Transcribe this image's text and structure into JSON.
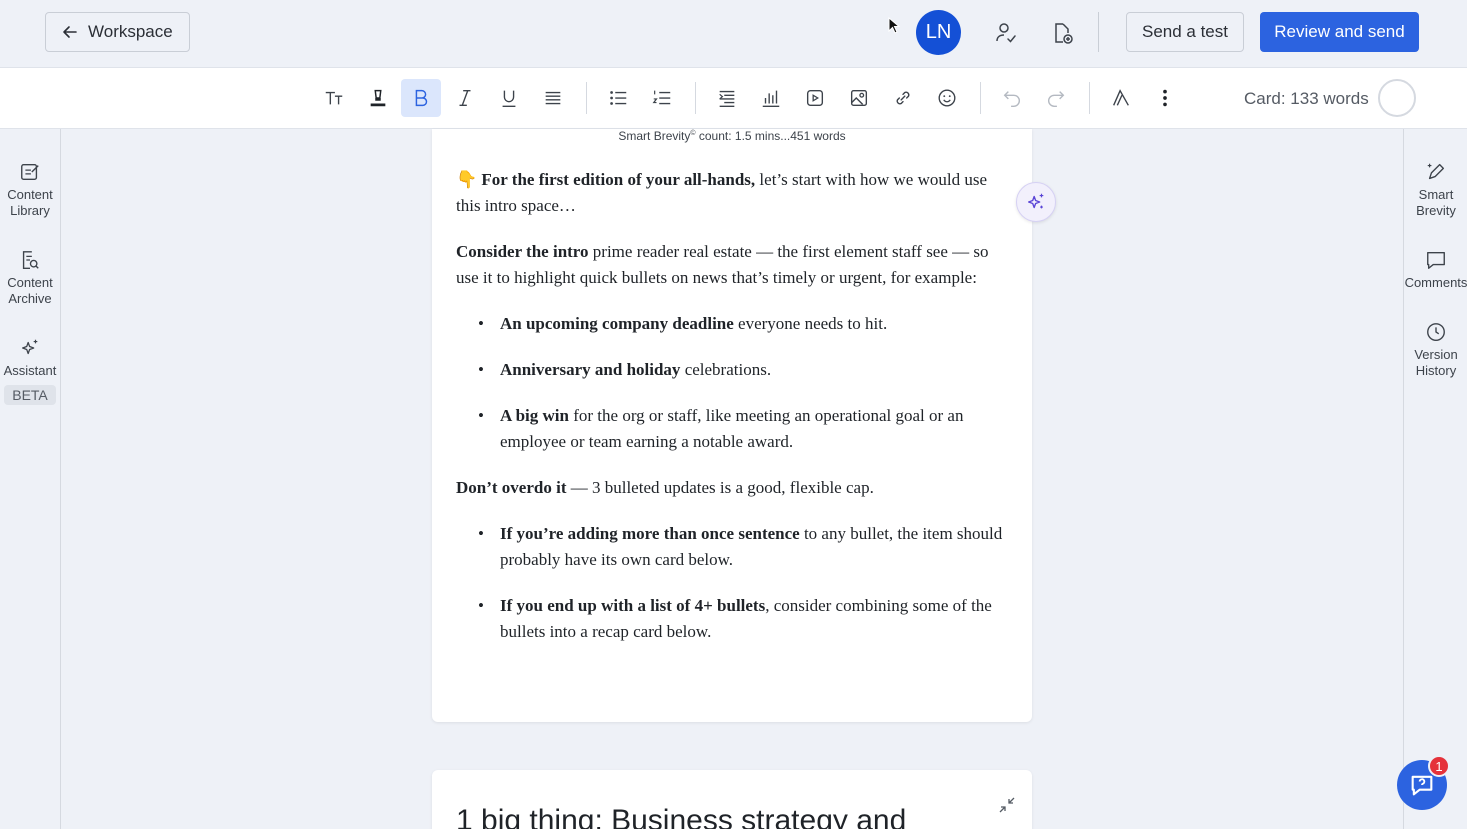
{
  "header": {
    "back_label": "Workspace",
    "avatar_initials": "LN",
    "send_test_label": "Send a test",
    "review_send_label": "Review and send",
    "accent": "#2c63e0"
  },
  "toolbar": {
    "tools": [
      "text-style",
      "highlight",
      "bold",
      "italic",
      "underline",
      "align",
      "bulleted-list",
      "numbered-list",
      "divider-insert",
      "chart",
      "embed",
      "image",
      "link",
      "emoji",
      "undo",
      "redo",
      "brand-style",
      "more"
    ],
    "active_tool": "bold",
    "word_count": "Card: 133 words"
  },
  "left_rail": {
    "items": [
      {
        "label": "Content Library",
        "icon": "edit-note-icon"
      },
      {
        "label": "Content Archive",
        "icon": "archive-search-icon"
      },
      {
        "label": "Assistant",
        "icon": "sparkle-icon",
        "badge": "BETA"
      }
    ]
  },
  "right_rail": {
    "items": [
      {
        "label": "Smart Brevity",
        "icon": "pen-sparkle-icon"
      },
      {
        "label": "Comments",
        "icon": "comment-icon"
      },
      {
        "label": "Version History",
        "icon": "clock-icon"
      }
    ]
  },
  "card": {
    "smart_brevity_prefix": "Smart Brevity",
    "smart_brevity_mark": "©",
    "smart_brevity_suffix": " count: 1.5 mins...451 words",
    "p1_emoji": "👇",
    "p1_bold": "For the first edition of your all-hands,",
    "p1_rest": " let’s start with how we would use this intro space…",
    "p2_bold": "Consider the intro",
    "p2_rest": " prime reader real estate — the first element staff see — so use it to highlight quick bullets on news that’s timely or urgent, for example:",
    "bullets1": [
      {
        "bold": "An upcoming company deadline",
        "rest": " everyone needs to hit."
      },
      {
        "bold": "Anniversary and holiday",
        "rest": " celebrations."
      },
      {
        "bold": "A big win",
        "rest": " for the org or staff, like meeting an operational goal or an employee or team earning a notable award."
      }
    ],
    "p3_bold": "Don’t overdo it",
    "p3_rest": " — 3 bulleted updates is a good, flexible cap.",
    "bullets2": [
      {
        "bold": "If you’re adding more than once sentence",
        "rest": " to any bullet, the item should probably have its own card below."
      },
      {
        "bold": "If you end up with a list of 4+ bullets",
        "rest": ", consider combining some of the bullets into a recap card below."
      }
    ]
  },
  "card2": {
    "title": "1 big thing: Business strategy and"
  },
  "help": {
    "badge_count": "1"
  }
}
